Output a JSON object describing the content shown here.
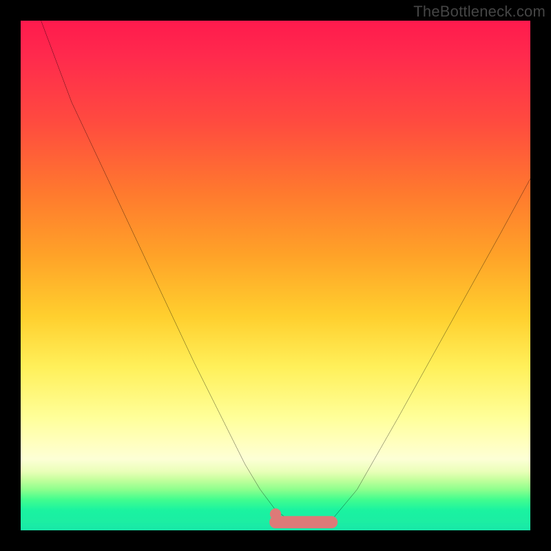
{
  "watermark": "TheBottleneck.com",
  "chart_data": {
    "type": "line",
    "title": "",
    "xlabel": "",
    "ylabel": "",
    "xlim": [
      0,
      100
    ],
    "ylim": [
      0,
      100
    ],
    "series": [
      {
        "name": "bottleneck-curve",
        "x": [
          4,
          10,
          18,
          26,
          34,
          40,
          44,
          47,
          50,
          52,
          55,
          58,
          60,
          61,
          66,
          74,
          84,
          94,
          100
        ],
        "values": [
          100,
          84,
          67,
          50,
          33,
          21,
          13,
          8,
          4,
          2.5,
          1.6,
          1.2,
          1.3,
          2,
          8,
          22,
          40,
          58,
          69
        ]
      }
    ],
    "annotations": [
      {
        "name": "optimal-zone",
        "type": "segment",
        "color": "#dd7a78",
        "x": [
          50,
          61
        ],
        "y": [
          1.6,
          1.6
        ]
      },
      {
        "name": "optimal-dot",
        "type": "point",
        "color": "#dd7a78",
        "x": 50,
        "y": 3.2
      }
    ],
    "background_gradient": {
      "top": "#ff1a4d",
      "mid": "#ffff9a",
      "bottom": "#16e9a8"
    }
  }
}
